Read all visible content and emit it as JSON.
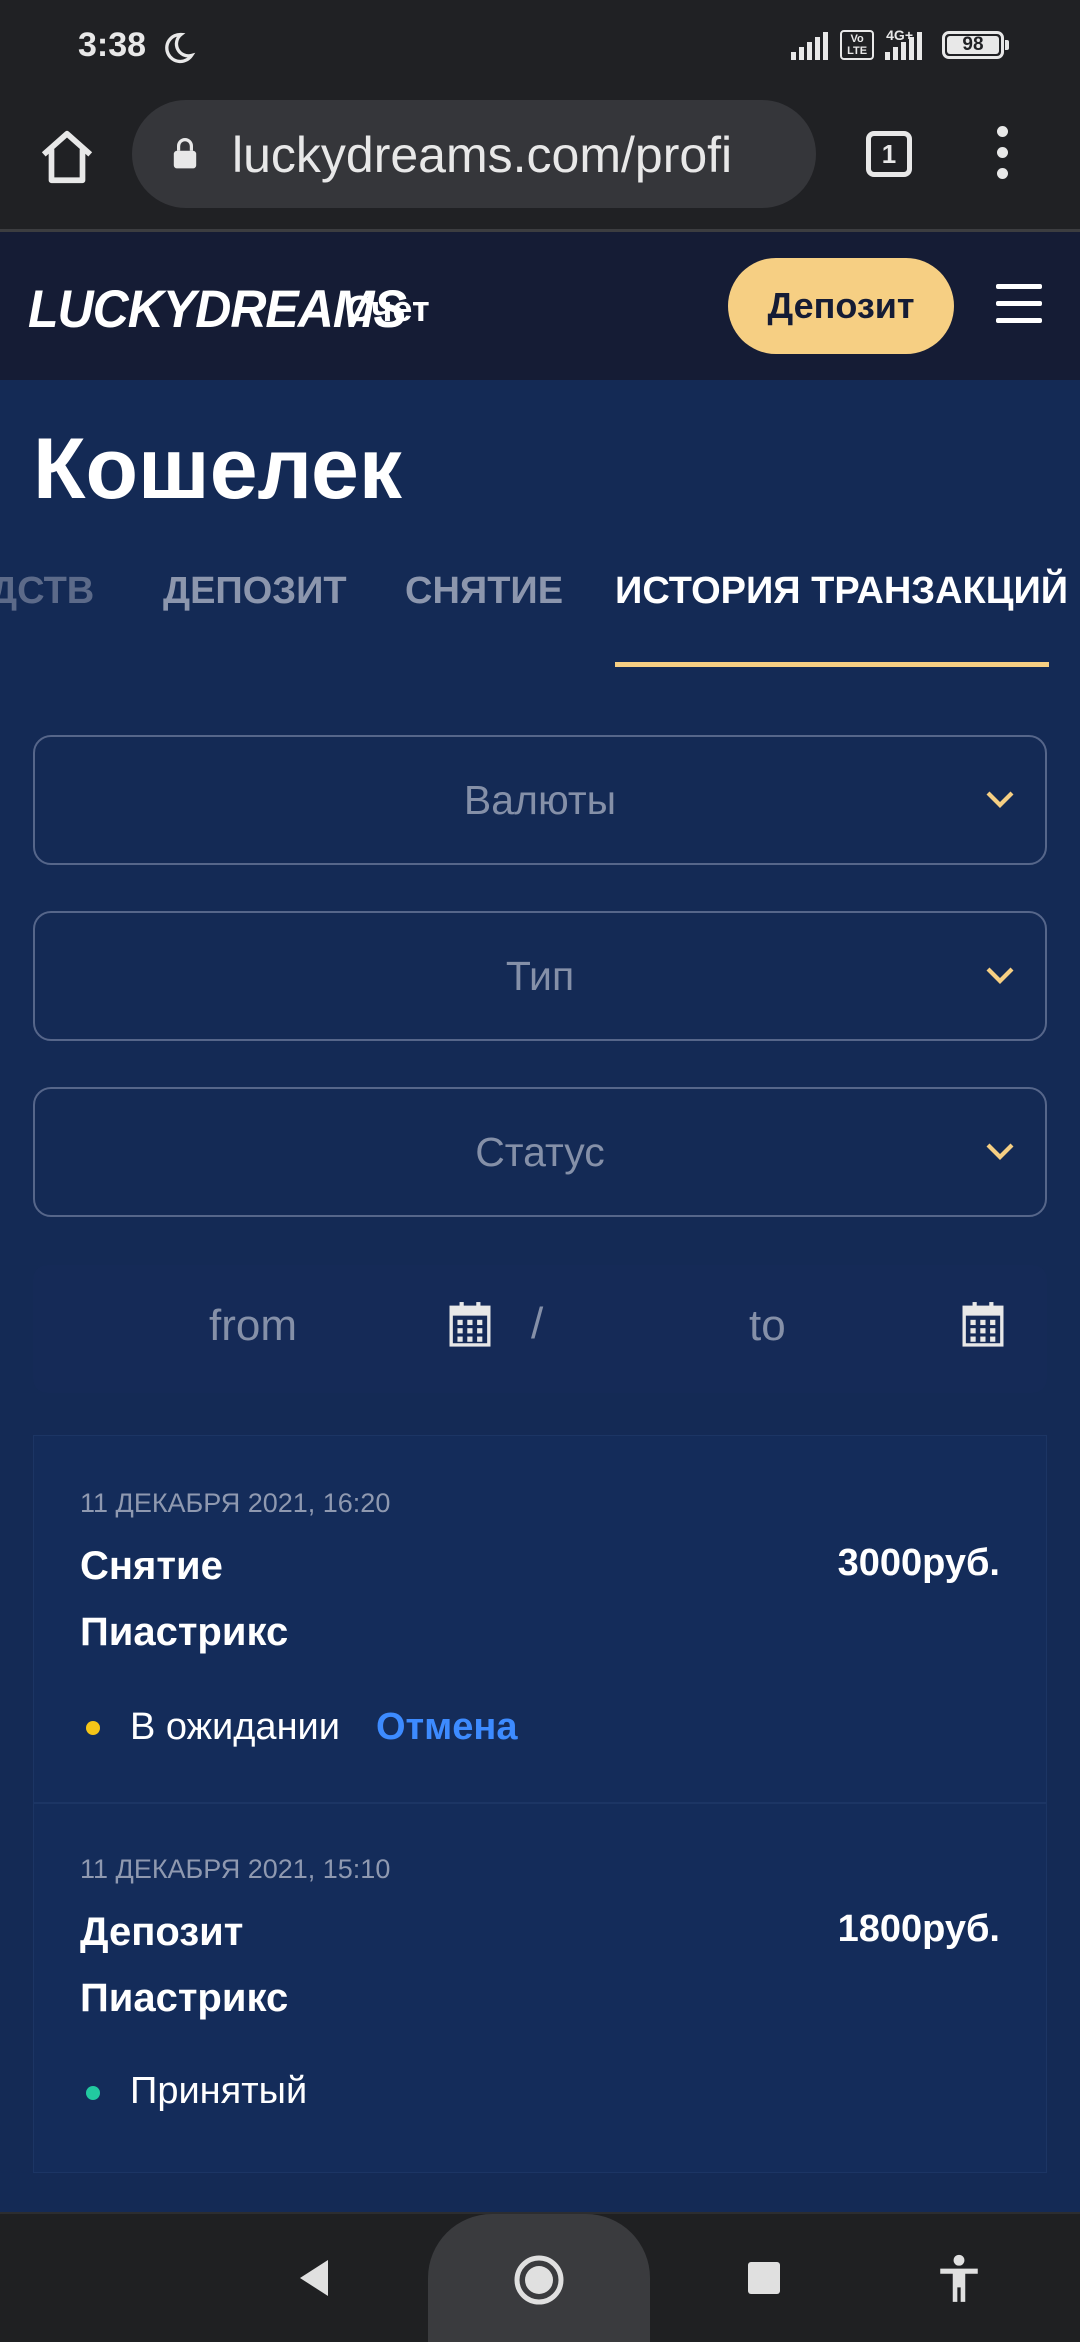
{
  "status_bar": {
    "time": "3:38",
    "battery": "98",
    "volte": "Vo LTE",
    "network": "4G+"
  },
  "browser": {
    "url": "luckydreams.com/profi",
    "tab_count": "1"
  },
  "site_header": {
    "logo": "LUCKYDREAMS",
    "account_label": "Счет",
    "deposit_button": "Депозит"
  },
  "page": {
    "title": "Кошелек",
    "tabs": [
      {
        "label": "СРЕДСТВ",
        "active": false
      },
      {
        "label": "ДЕПОЗИТ",
        "active": false
      },
      {
        "label": "СНЯТИЕ",
        "active": false
      },
      {
        "label": "ИСТОРИЯ ТРАНЗАКЦИЙ",
        "active": true
      }
    ],
    "tab_visible_0": "ДСТВ"
  },
  "filters": {
    "currency_placeholder": "Валюты",
    "type_placeholder": "Тип",
    "status_placeholder": "Статус",
    "date_from": "from",
    "date_separator": "/",
    "date_to": "to"
  },
  "transactions": [
    {
      "date": "11 ДЕКАБРЯ 2021, 16:20",
      "type": "Снятие",
      "method": "Пиастрикс",
      "amount": "3000руб.",
      "status": "В ожидании",
      "status_color": "#f5c518",
      "action": "Отмена"
    },
    {
      "date": "11 ДЕКАБРЯ 2021, 15:10",
      "type": "Депозит",
      "method": "Пиастрикс",
      "amount": "1800руб.",
      "status": "Принятый",
      "status_color": "#22c9a0"
    }
  ],
  "colors": {
    "accent": "#f6cf83",
    "background": "#142a55",
    "header": "#151c35",
    "link": "#3d8bff"
  }
}
